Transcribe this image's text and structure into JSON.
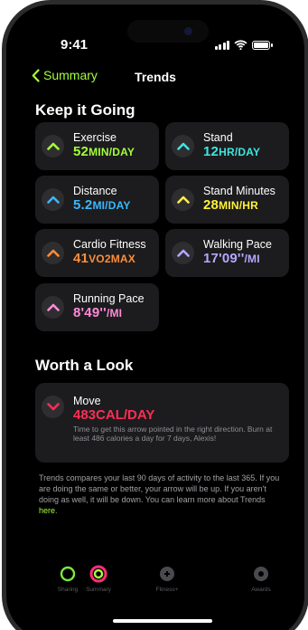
{
  "status": {
    "time": "9:41"
  },
  "nav": {
    "back_label": "Summary",
    "title": "Trends"
  },
  "keep_going": {
    "title": "Keep it Going",
    "cards": [
      {
        "label": "Exercise",
        "value": "52",
        "unit": "MIN/DAY",
        "color": "#a4ff3a"
      },
      {
        "label": "Stand",
        "value": "12",
        "unit": "HR/DAY",
        "color": "#3ee6e0"
      },
      {
        "label": "Distance",
        "value": "5.2",
        "unit": "MI/DAY",
        "color": "#3bb7ff"
      },
      {
        "label": "Stand Minutes",
        "value": "28",
        "unit": "MIN/HR",
        "color": "#fff23a"
      },
      {
        "label": "Cardio Fitness",
        "value": "41",
        "unit": "VO2MAX",
        "color": "#ff8d3a"
      },
      {
        "label": "Walking Pace",
        "value": "17'09''",
        "unit": "/MI",
        "color": "#b8a6ff"
      },
      {
        "label": "Running Pace",
        "value": "8'49''",
        "unit": "/MI",
        "color": "#ff8ad6"
      }
    ]
  },
  "worth_look": {
    "title": "Worth a Look",
    "card": {
      "label": "Move",
      "value": "483",
      "unit": "CAL/DAY",
      "color": "#ff2d55",
      "description": "Time to get this arrow pointed in the right direction. Burn at least 486 calories a day for 7 days, Alexis!"
    }
  },
  "footer": {
    "text": "Trends compares your last 90 days of activity to the last 365. If you are doing the same or better, your arrow will be up. If you aren't doing as well, it will be down. You can learn more about Trends ",
    "link": "here",
    "end": "."
  },
  "tabs": [
    {
      "label": "Sharing"
    },
    {
      "label": "Summary"
    },
    {
      "label": "Fitness+"
    },
    {
      "label": "Awards"
    }
  ]
}
